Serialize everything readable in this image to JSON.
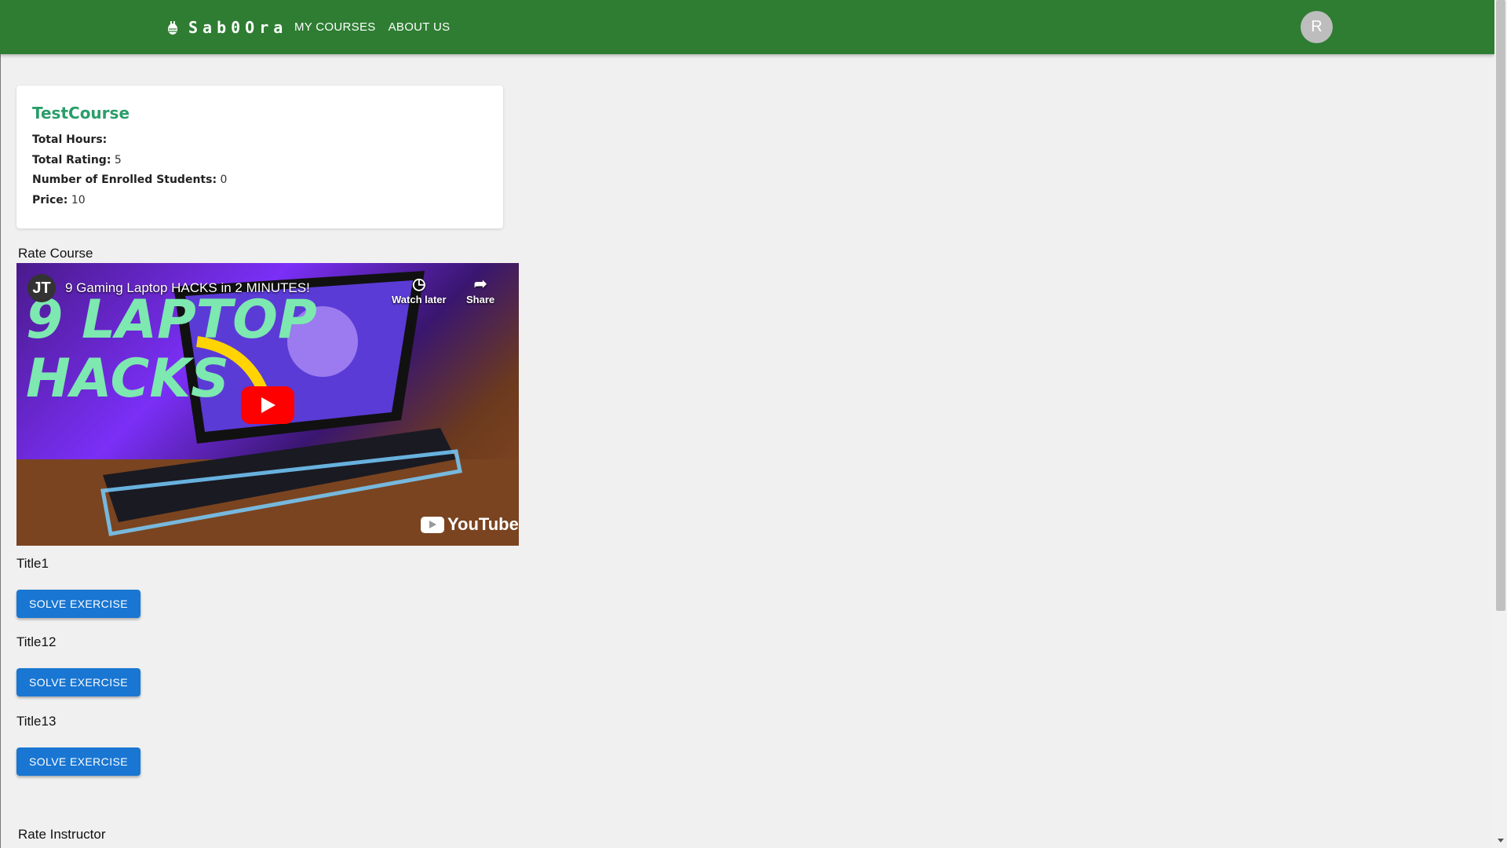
{
  "brand": {
    "name": "Sab0Ora",
    "icon": "bug-icon"
  },
  "nav": {
    "items": [
      "MY COURSES",
      "ABOUT US"
    ]
  },
  "user": {
    "avatar_initial": "R"
  },
  "course": {
    "title": "TestCourse",
    "stats": [
      {
        "label": "Total Hours:",
        "value": ""
      },
      {
        "label": "Total Rating:",
        "value": "5"
      },
      {
        "label": "Number of Enrolled Students:",
        "value": "0"
      },
      {
        "label": "Price:",
        "value": "10"
      }
    ]
  },
  "rate_course_label": "Rate Course",
  "video": {
    "channel_initial": "JT",
    "title": "9 Gaming Laptop HACKS in 2 MINUTES!",
    "watch_later": "Watch later",
    "share": "Share",
    "thumbnail_text": [
      "9 LAPTOP",
      "HACKS"
    ],
    "logo_text": "YouTube"
  },
  "lessons": [
    {
      "title": "Title1",
      "button": "SOLVE EXERCISE"
    },
    {
      "title": "Title12",
      "button": "SOLVE EXERCISE"
    },
    {
      "title": "Title13",
      "button": "SOLVE EXERCISE"
    }
  ],
  "rate_instructor_label": "Rate Instructor",
  "colors": {
    "appbar": "#2e7d32",
    "button": "#1976d2",
    "course_title": "#2a9d6a"
  }
}
